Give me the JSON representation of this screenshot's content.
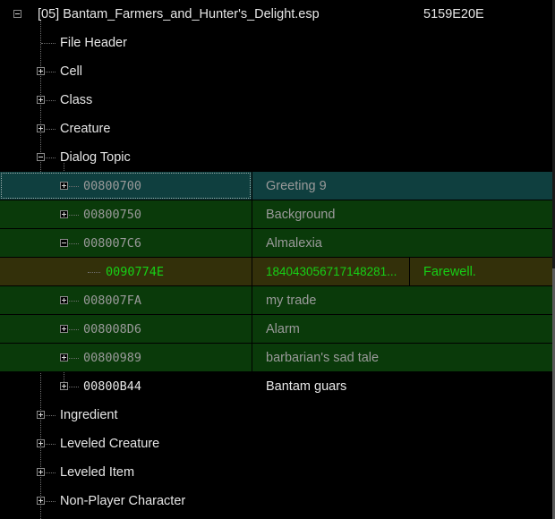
{
  "plugin": {
    "name": "[05] Bantam_Farmers_and_Hunter's_Delight.esp",
    "form_id": "5159E20E"
  },
  "categories": {
    "file_header": "File Header",
    "cell": "Cell",
    "class": "Class",
    "creature": "Creature",
    "dialog_topic": "Dialog Topic",
    "ingredient": "Ingredient",
    "leveled_creature": "Leveled Creature",
    "leveled_item": "Leveled Item",
    "non_player_character": "Non-Player Character"
  },
  "dialog_entries": [
    {
      "id": "00800700",
      "name": "Greeting 9"
    },
    {
      "id": "00800750",
      "name": "Background"
    },
    {
      "id": "008007C6",
      "name": "Almalexia"
    },
    {
      "id": "008007FA",
      "name": "my trade"
    },
    {
      "id": "008008D6",
      "name": "Alarm"
    },
    {
      "id": "00800989",
      "name": "barbarian's sad tale"
    },
    {
      "id": "00800B44",
      "name": "Bantam guars"
    }
  ],
  "info_entry": {
    "id": "0090774E",
    "value": "184043056717148281...",
    "name": "Farewell."
  },
  "colors": {
    "selected_row": "#0f3f3f",
    "override_row": "#0a3a0a",
    "conflict_row": "#33300a",
    "green_text": "#16d016"
  }
}
